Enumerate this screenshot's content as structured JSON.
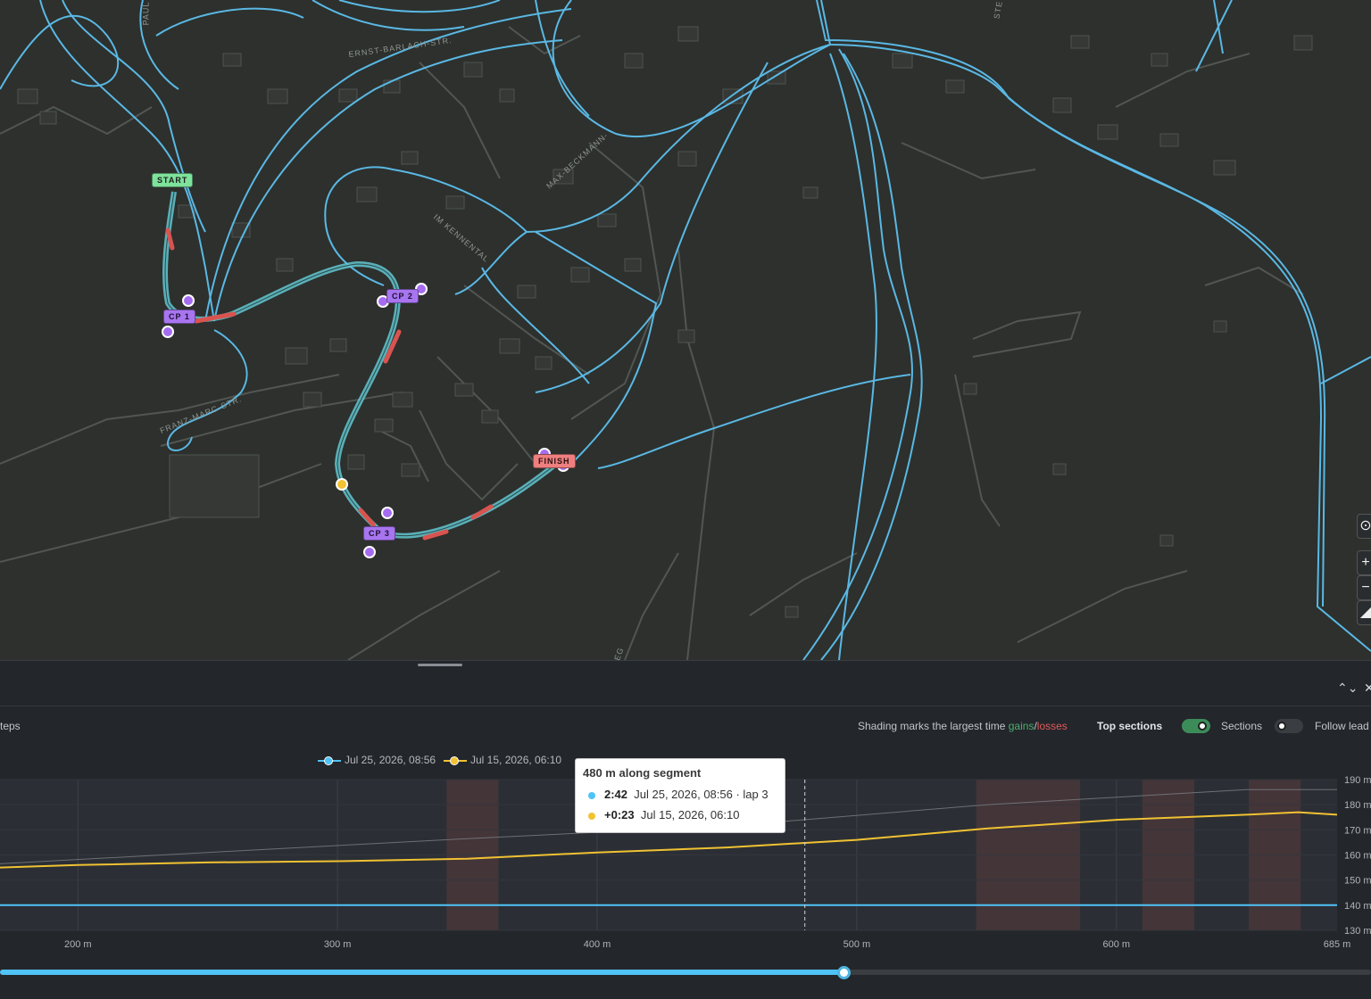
{
  "map": {
    "street_labels": [
      {
        "text": "PAUL",
        "name": "street-label-paul"
      },
      {
        "text": "ERNST-BARLACH-STR.",
        "name": "street-label-ernst-barlach"
      },
      {
        "text": "MAX-BECKMANN-",
        "name": "street-label-max-beckmann"
      },
      {
        "text": "IM KENNENTAL",
        "name": "street-label-im-kennental"
      },
      {
        "text": "FRANZ-MARC-STR.",
        "name": "street-label-franz-marc"
      },
      {
        "text": "STE",
        "name": "street-label-ste"
      },
      {
        "text": "EG",
        "name": "street-label-eg"
      }
    ],
    "markers": {
      "start": "START",
      "cp1": "CP 1",
      "cp2": "CP 2",
      "cp3": "CP 3",
      "finish": "FINISH"
    },
    "controls": {
      "locate": "⊙",
      "zoom_in": "+",
      "zoom_out": "−",
      "compass": "◢"
    }
  },
  "panel": {
    "header": {
      "expand_icon": "⌃⌄",
      "close_icon": "✕"
    },
    "toolbar": {
      "left_text": "teps",
      "shading_prefix": "Shading marks the largest time ",
      "gains": "gains",
      "slash": "/",
      "losses": "losses",
      "top_sections": "Top sections",
      "sections": "Sections",
      "follow_leader": "Follow lead"
    },
    "legend": [
      {
        "label": "Jul 25, 2026, 08:56",
        "color": "#4fc3f7"
      },
      {
        "label": "Jul 15, 2026, 06:10",
        "color": "#f1c232"
      }
    ],
    "tooltip": {
      "title": "480 m along segment",
      "rows": [
        {
          "value": "2:42",
          "detail": "Jul 25, 2026, 08:56 · lap 3",
          "color": "#4fc3f7"
        },
        {
          "value": "+0:23",
          "detail": "Jul 15, 2026, 06:10",
          "color": "#f1c232"
        }
      ]
    },
    "slider": {
      "progress_fraction": 0.615
    }
  },
  "chart_data": {
    "type": "line",
    "xlabel": "",
    "ylabel": "",
    "x_ticks": [
      "200 m",
      "300 m",
      "400 m",
      "500 m",
      "600 m",
      "685 m"
    ],
    "y_ticks": [
      "190 m",
      "180 m",
      "170 m",
      "160 m",
      "150 m",
      "140 m",
      "130 m"
    ],
    "x_range": [
      170,
      685
    ],
    "y_range": [
      130,
      190
    ],
    "cursor_x": 480,
    "shaded_sections_loss": [
      [
        342,
        362
      ],
      [
        546,
        586
      ],
      [
        610,
        630
      ],
      [
        651,
        671
      ]
    ],
    "series": [
      {
        "name": "Jul 25, 2026, 08:56",
        "color": "#4fc3f7",
        "x": [
          170,
          685
        ],
        "y": [
          140,
          140
        ]
      },
      {
        "name": "Jul 15, 2026, 06:10",
        "color": "#f1c232",
        "x": [
          170,
          200,
          250,
          300,
          350,
          400,
          450,
          500,
          550,
          600,
          650,
          670,
          685
        ],
        "y": [
          155,
          156,
          157,
          157.5,
          158.5,
          161,
          163,
          166,
          170.5,
          174,
          176,
          177,
          176
        ]
      },
      {
        "name": "",
        "color": "#7d8186",
        "x": [
          170,
          250,
          350,
          450,
          550,
          650,
          685
        ],
        "y": [
          156.5,
          161,
          166.5,
          171.5,
          180,
          186,
          186
        ]
      }
    ]
  }
}
